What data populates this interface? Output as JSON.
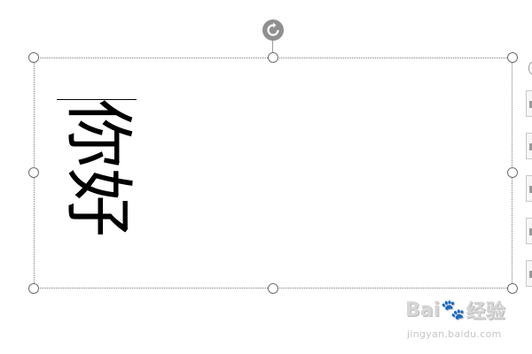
{
  "text_box": {
    "text": "你好",
    "text_direction": "rotated-90"
  },
  "selection": {
    "frame_style": "dotted",
    "handle_count": 8,
    "rotation_handle_icon": "rotate-icon"
  },
  "side_toolbar": {
    "buttons": [
      "layout-options-button",
      "style-button",
      "fill-button",
      "outline-button",
      "more-button"
    ]
  },
  "watermark": {
    "logo_text_1": "Bai",
    "logo_paw": "🐾",
    "logo_text_2": "经验",
    "url": "jingyan.baidu.com"
  },
  "colors": {
    "text": "#000000",
    "frame": "#7a7a7a",
    "handle_border": "#6e6e6e",
    "rotate_handle": "#8f8f8f",
    "watermark": "#d7d7d7"
  }
}
